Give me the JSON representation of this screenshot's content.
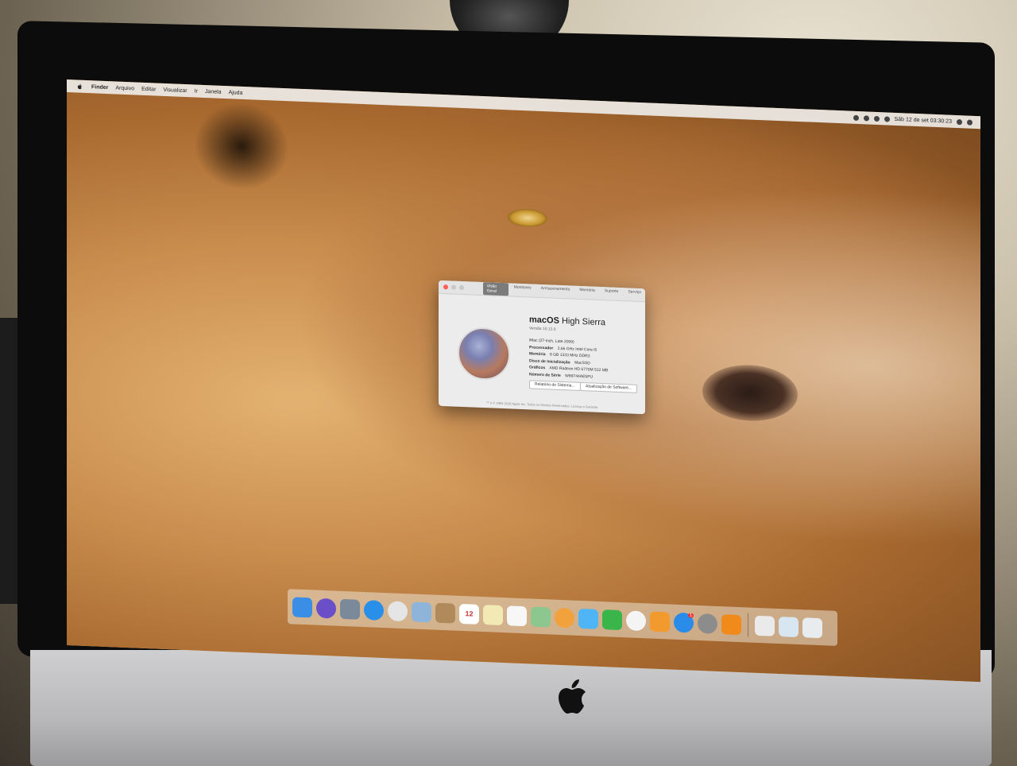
{
  "menubar": {
    "items": [
      "Finder",
      "Arquivo",
      "Editar",
      "Visualizar",
      "Ir",
      "Janela",
      "Ajuda"
    ],
    "clock": "Sáb 12 de set  03:30:23"
  },
  "about_window": {
    "tabs": [
      "Visão Geral",
      "Monitores",
      "Armazenamento",
      "Memória",
      "Suporte",
      "Serviço"
    ],
    "active_tab": "Visão Geral",
    "os_name_bold": "macOS",
    "os_name_rest": "High Sierra",
    "version": "Versão 10.13.6",
    "specs": [
      {
        "key": "",
        "value": "iMac (27-inch, Late 2009)"
      },
      {
        "key": "Processador",
        "value": "2,66 GHz Intel Core i5"
      },
      {
        "key": "Memória",
        "value": "8 GB 1333 MHz DDR3"
      },
      {
        "key": "Disco de Inicialização",
        "value": "MacSSD"
      },
      {
        "key": "Gráficos",
        "value": "AMD Radeon HD 6770M 512 MB"
      },
      {
        "key": "Número de Série",
        "value": "W89744AE5PU"
      }
    ],
    "buttons": {
      "report": "Relatório do Sistema...",
      "update": "Atualização de Software..."
    },
    "footer": "™ e © 1983-2018 Apple Inc. Todos os Direitos Reservados. Licença e Garantia"
  },
  "dock": {
    "calendar_day": "12",
    "appstore_badge": "1",
    "icons": [
      {
        "name": "finder-icon",
        "color": "#3a8ee6"
      },
      {
        "name": "siri-icon",
        "color": "#6b4fc8"
      },
      {
        "name": "launchpad-icon",
        "color": "#7a8a9a"
      },
      {
        "name": "safari-icon",
        "color": "#2a8fe8"
      },
      {
        "name": "chrome-icon",
        "color": "#e5e5e5"
      },
      {
        "name": "mail-icon",
        "color": "#8fb4d9"
      },
      {
        "name": "contacts-icon",
        "color": "#b08a5a"
      },
      {
        "name": "calendar-icon",
        "color": "#ffffff"
      },
      {
        "name": "notes-icon",
        "color": "#f3e9b5"
      },
      {
        "name": "reminders-icon",
        "color": "#f7f7f7"
      },
      {
        "name": "maps-icon",
        "color": "#8bc78f"
      },
      {
        "name": "photos-icon",
        "color": "#f2a23d"
      },
      {
        "name": "messages-icon",
        "color": "#4fb5f5"
      },
      {
        "name": "facetime-icon",
        "color": "#3ab54a"
      },
      {
        "name": "itunes-icon",
        "color": "#f4f4f4"
      },
      {
        "name": "ibooks-icon",
        "color": "#f29a2e"
      },
      {
        "name": "app-store-icon",
        "color": "#2a8be8"
      },
      {
        "name": "system-preferences-icon",
        "color": "#8c8c8c"
      },
      {
        "name": "vlc-icon",
        "color": "#f08a1a"
      },
      {
        "name": "downloads-icon",
        "color": "#eaeaea"
      },
      {
        "name": "folder-icon",
        "color": "#d8e6f2"
      },
      {
        "name": "trash-icon",
        "color": "#e9ecef"
      }
    ]
  }
}
